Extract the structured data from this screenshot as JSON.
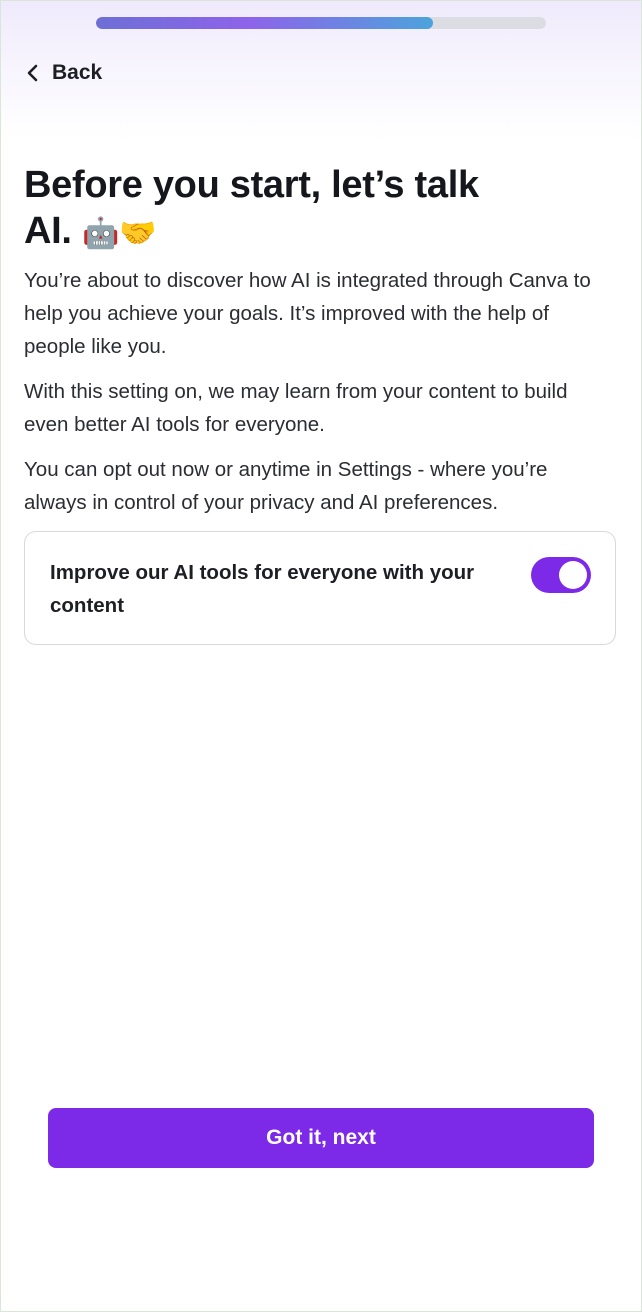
{
  "header": {
    "progress_fraction": 0.748,
    "progress_colors": [
      "#6d6fd6",
      "#8e63ea",
      "#4da3dc"
    ],
    "back_label": "Back",
    "back_icon": "chevron-left-icon"
  },
  "main": {
    "title_line1": "Before you start, let’s talk",
    "title_line2": "AI.",
    "title_emojis": [
      "robot-icon",
      "handshake-icon"
    ],
    "paragraph1": "You’re about to discover how AI is integrated through Canva to help you achieve your goals. It’s improved with the help of people like you.",
    "paragraph2": "With this setting on, we may learn from your content to build even better AI tools for everyone.",
    "paragraph3": "You can opt out now or anytime in Settings - where you’re always in control of your privacy and AI preferences."
  },
  "setting": {
    "label": "Improve our AI tools for everyone with your content",
    "enabled": true,
    "accent_color": "#7d2ae8"
  },
  "footer": {
    "primary_button_label": "Got it, next",
    "button_color": "#7d2ae8"
  }
}
